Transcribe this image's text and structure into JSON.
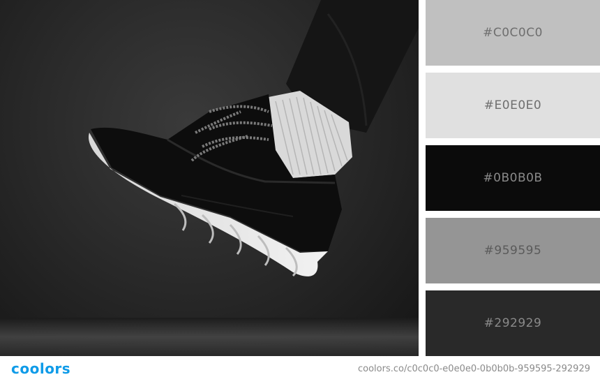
{
  "palette": {
    "swatches": [
      {
        "label": "#C0C0C0",
        "color": "#C0C0C0",
        "text_color": "#6e6e6e"
      },
      {
        "label": "#E0E0E0",
        "color": "#E0E0E0",
        "text_color": "#6e6e6e"
      },
      {
        "label": "#0B0B0B",
        "color": "#0B0B0B",
        "text_color": "#8a8a8a"
      },
      {
        "label": "#959595",
        "color": "#959595",
        "text_color": "#5a5a5a"
      },
      {
        "label": "#292929",
        "color": "#292929",
        "text_color": "#8a8a8a"
      }
    ]
  },
  "photo": {
    "subject": "sneaker-photo"
  },
  "footer": {
    "logo": "coolors",
    "url": "coolors.co/c0c0c0-e0e0e0-0b0b0b-959595-292929"
  }
}
